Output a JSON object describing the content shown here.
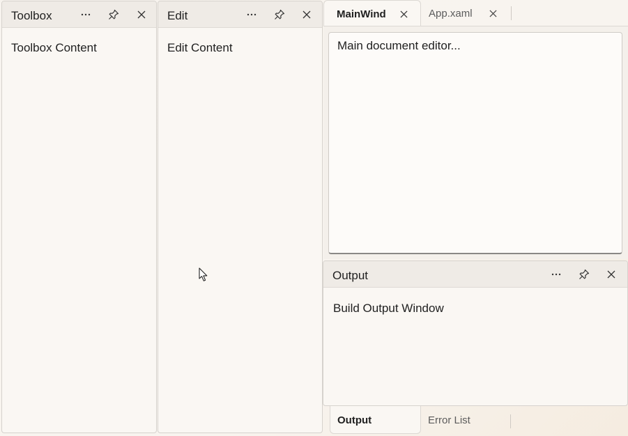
{
  "toolbox": {
    "title": "Toolbox",
    "content": "Toolbox Content",
    "menu_icon": "more-horizontal-icon",
    "pin_icon": "pin-icon",
    "close_icon": "close-icon"
  },
  "edit": {
    "title": "Edit",
    "content": "Edit Content",
    "menu_icon": "more-horizontal-icon",
    "pin_icon": "pin-icon",
    "close_icon": "close-icon"
  },
  "documents": {
    "tabs": [
      {
        "label": "MainWind",
        "active": true
      },
      {
        "label": "App.xaml",
        "active": false
      }
    ],
    "editor_text": "Main document editor..."
  },
  "output": {
    "title": "Output",
    "content": "Build Output Window",
    "menu_icon": "more-horizontal-icon",
    "pin_icon": "pin-icon",
    "close_icon": "close-icon"
  },
  "bottom_tabs": [
    {
      "label": "Output",
      "active": true
    },
    {
      "label": "Error List",
      "active": false
    }
  ],
  "colors": {
    "panel_background": "#faf7f3",
    "header_background": "#efebe6",
    "border": "#d6d2cd",
    "text": "#1f1f1f",
    "inactive_text": "#5c5c5c"
  }
}
